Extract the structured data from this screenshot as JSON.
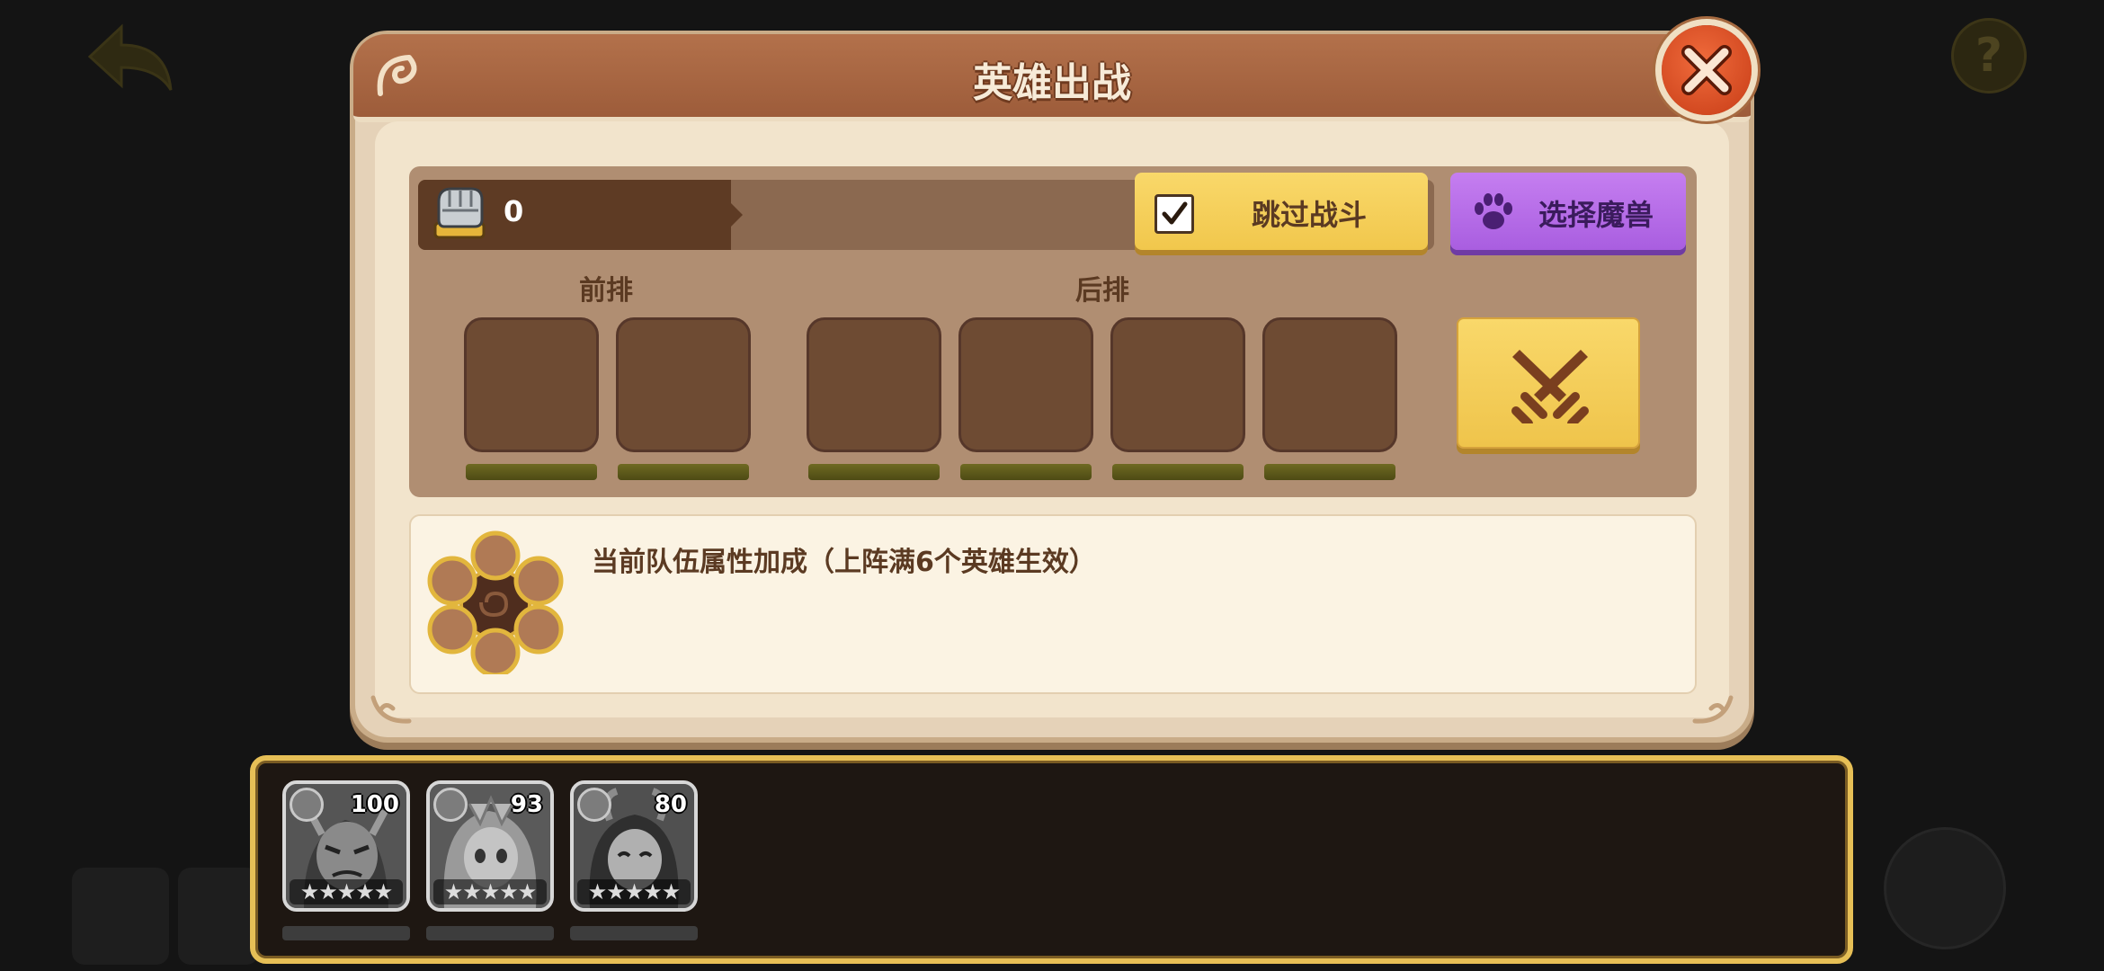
{
  "dialog": {
    "title": "英雄出战"
  },
  "lineup": {
    "power_value": "0",
    "skip_battle_label": "跳过战斗",
    "skip_battle_checked": true,
    "select_beast_label": "选择魔兽",
    "front_row_label": "前排",
    "back_row_label": "后排"
  },
  "bonus": {
    "text": "当前队伍属性加成（上阵满6个英雄生效）"
  },
  "roster": {
    "heroes": [
      {
        "level": "100",
        "stars": "★★★★★",
        "icon": "hero-portrait-orc"
      },
      {
        "level": "93",
        "stars": "★★★★★",
        "icon": "hero-portrait-elf"
      },
      {
        "level": "80",
        "stars": "★★★★★",
        "icon": "hero-portrait-demoness"
      }
    ]
  },
  "colors": {
    "title_bar": "#a8663f",
    "skip_button": "#f5cf5a",
    "beast_button": "#b86ae8",
    "close_button": "#e0532a",
    "roster_border": "#e6bf56"
  }
}
